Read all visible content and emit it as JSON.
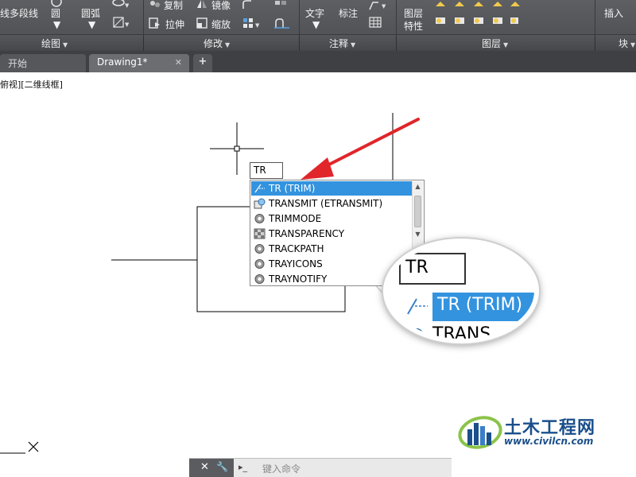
{
  "ribbon": {
    "draw_tools": {
      "polyline": "多段线",
      "circle": "圆",
      "arc": "圆弧"
    },
    "modify_tools": {
      "copy": "复制",
      "mirror": "镜像",
      "stretch": "拉伸",
      "scale": "缩放"
    },
    "annotation_tools": {
      "text": "文字",
      "dimension": "标注"
    },
    "layer_tools": {
      "layer_properties_line1": "图层",
      "layer_properties_line2": "特性"
    },
    "block_tools": {
      "insert": "插入"
    },
    "panels": {
      "draw": "绘图",
      "modify": "修改",
      "annotation": "注释",
      "layers": "图层",
      "block": "块"
    }
  },
  "tabs": {
    "start": "开始",
    "active": "Drawing1*",
    "close": "✕",
    "add": "+"
  },
  "viewport": {
    "label": "俯视][二维线框]"
  },
  "command": {
    "input_value": "TR",
    "suggestions": [
      {
        "label": "TR (TRIM)",
        "icon": "trim-icon",
        "selected": true
      },
      {
        "label": "TRANSMIT (ETRANSMIT)",
        "icon": "etransmit-icon",
        "selected": false
      },
      {
        "label": "TRIMMODE",
        "icon": "gear-icon",
        "selected": false
      },
      {
        "label": "TRANSPARENCY",
        "icon": "transparency-icon",
        "selected": false
      },
      {
        "label": "TRACKPATH",
        "icon": "gear-icon",
        "selected": false
      },
      {
        "label": "TRAYICONS",
        "icon": "gear-icon",
        "selected": false
      },
      {
        "label": "TRAYNOTIFY",
        "icon": "gear-icon",
        "selected": false
      }
    ],
    "placeholder": "键入命令"
  },
  "magnifier": {
    "input_value": "TR",
    "selected_label": "TR (TRIM)",
    "next_label": "TRANS"
  },
  "commandline": {
    "close": "✕",
    "wrench": "🔧",
    "prompt": "▸_"
  },
  "watermark": {
    "name": "土木工程网",
    "url": "www.civilcn.com"
  },
  "colors": {
    "ribbon_bg": "#4b4d51",
    "selection": "#3393df",
    "annotation_arrow": "#e0252b",
    "watermark_blue": "#1a4f8b"
  }
}
